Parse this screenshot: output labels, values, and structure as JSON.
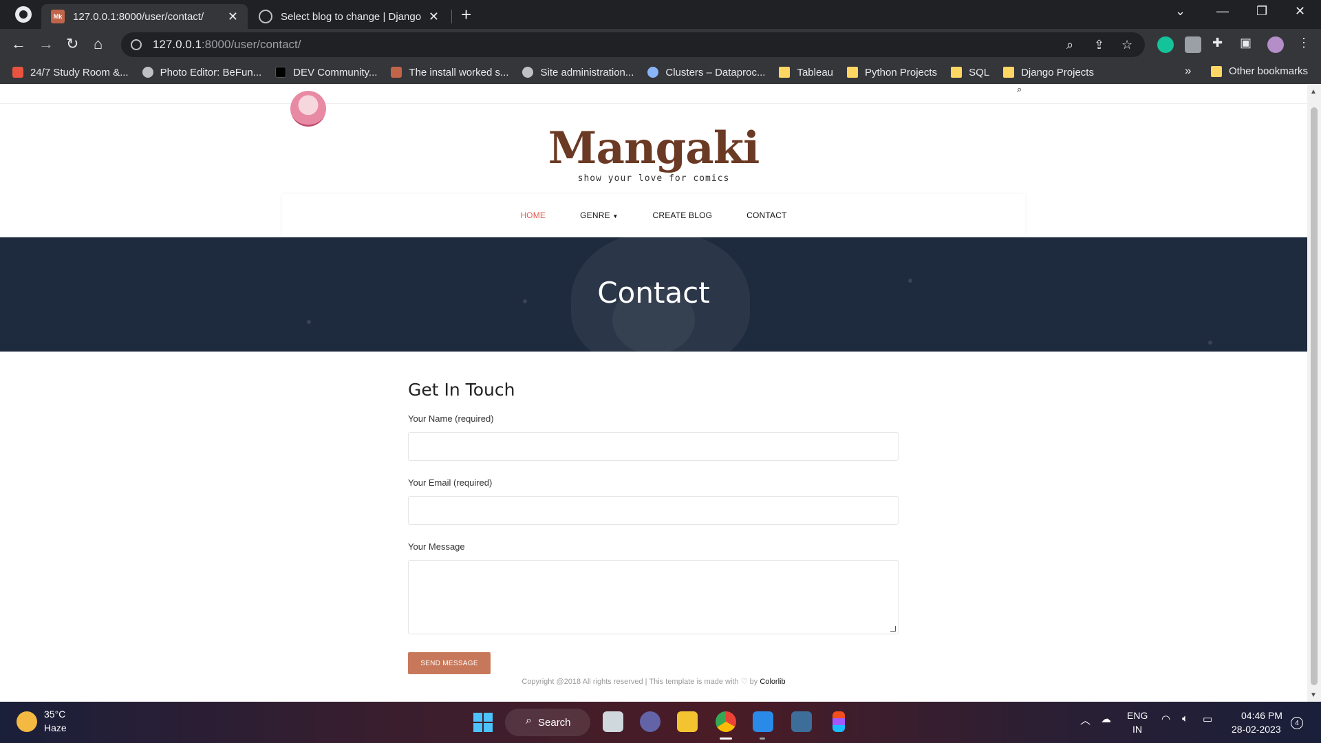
{
  "browser": {
    "tabs": [
      {
        "title": "127.0.0.1:8000/user/contact/",
        "favicon": "mk-favicon",
        "active": true
      },
      {
        "title": "Select blog to change | Django si",
        "favicon": "globe-icon",
        "active": false
      }
    ],
    "address": {
      "host": "127.0.0.1",
      "path": ":8000/user/contact/"
    },
    "bookmarks": [
      {
        "label": "24/7 Study Room &...",
        "icon": "red"
      },
      {
        "label": "Photo Editor: BeFun...",
        "icon": "round"
      },
      {
        "label": "DEV Community...",
        "icon": "dev"
      },
      {
        "label": "The install worked s...",
        "icon": "mk"
      },
      {
        "label": "Site administration...",
        "icon": "round"
      },
      {
        "label": "Clusters – Dataproc...",
        "icon": "blue"
      },
      {
        "label": "Tableau",
        "icon": "folder"
      },
      {
        "label": "Python Projects",
        "icon": "folder"
      },
      {
        "label": "SQL",
        "icon": "folder"
      },
      {
        "label": "Django Projects",
        "icon": "folder"
      }
    ],
    "bookmarks_more": "»",
    "other_bookmarks": "Other bookmarks"
  },
  "site": {
    "logo": "Mangaki",
    "tagline": "show your love for comics",
    "nav": {
      "home": "HOME",
      "genre": "GENRE",
      "create_blog": "CREATE BLOG",
      "contact": "CONTACT"
    },
    "banner_title": "Contact",
    "form": {
      "heading": "Get In Touch",
      "name_label": "Your Name (required)",
      "email_label": "Your Email (required)",
      "message_label": "Your Message",
      "name_value": "",
      "email_value": "",
      "message_value": "",
      "submit": "SEND MESSAGE"
    },
    "footer": {
      "text": "Copyright @2018 All rights reserved | This template is made with",
      "by": "by",
      "link": "Colorlib"
    },
    "accent_color": "#e4584a",
    "button_color": "#c8785a"
  },
  "taskbar": {
    "weather_temp": "35°C",
    "weather_desc": "Haze",
    "search_label": "Search",
    "lang_top": "ENG",
    "lang_bottom": "IN",
    "time": "04:46 PM",
    "date": "28-02-2023",
    "notifications": "4"
  }
}
